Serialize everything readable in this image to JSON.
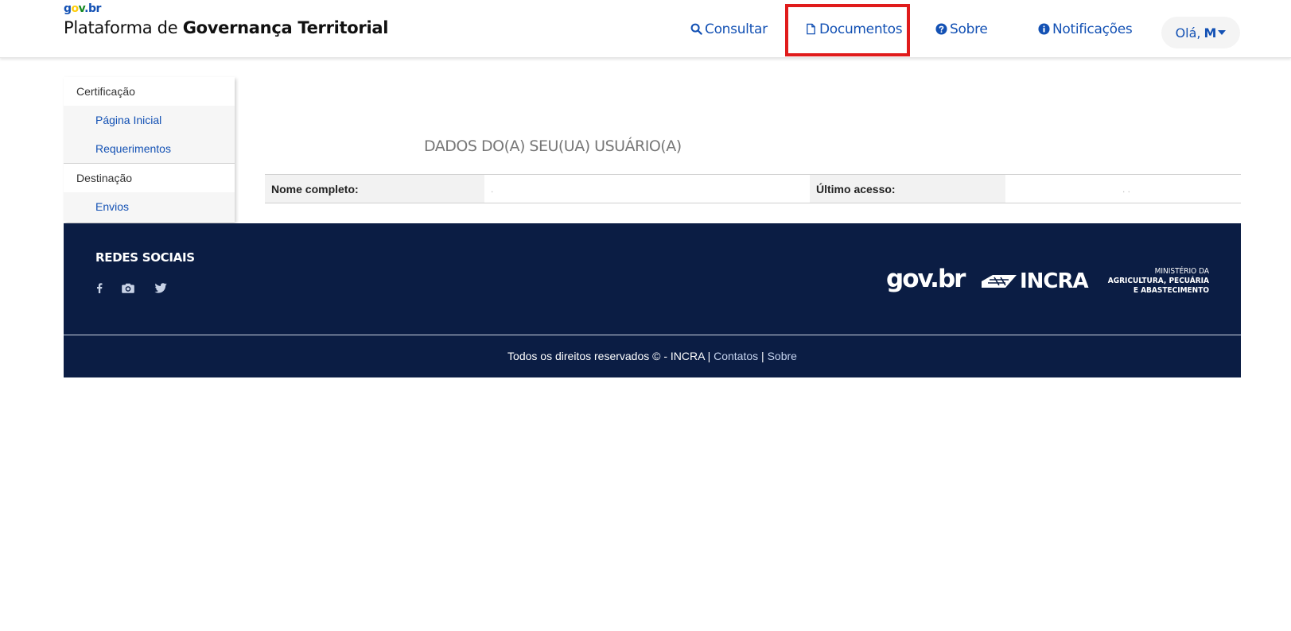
{
  "header": {
    "logo": {
      "g": "g",
      "o": "o",
      "v": "v",
      "dot": ".",
      "br": "br"
    },
    "title_prefix": "Plataforma de ",
    "title_bold": "Governança Territorial",
    "nav": {
      "consultar": "Consultar",
      "documentos": "Documentos",
      "sobre": "Sobre",
      "notificacoes": "Notificações"
    },
    "user_greeting": "Olá,",
    "user_name": "M",
    "icons": [
      "search-icon",
      "file-icon",
      "question-circle-icon",
      "info-circle-icon",
      "caret-down-icon"
    ],
    "highlight_color": "#e01b1b"
  },
  "sidebar": {
    "sections": [
      {
        "label": "Certificação",
        "items": [
          {
            "label": "Página Inicial"
          },
          {
            "label": "Requerimentos"
          }
        ]
      },
      {
        "label": "Destinação",
        "items": [
          {
            "label": "Envios"
          }
        ]
      }
    ]
  },
  "main": {
    "section_title": "DADOS DO(A) SEU(UA) USUÁRIO(A)",
    "table": {
      "nome_label": "Nome completo:",
      "nome_value": ".",
      "acesso_label": "Último acesso:",
      "acesso_value": ". ."
    }
  },
  "footer": {
    "social_title": "REDES SOCIAIS",
    "social_icons": [
      "facebook-icon",
      "instagram-icon",
      "twitter-icon"
    ],
    "logos": {
      "govbr": "gov.br",
      "incra": "INCRA",
      "ministerio_l1": "MINISTÉRIO DA",
      "ministerio_l2": "AGRICULTURA, PECUÁRIA",
      "ministerio_l3": "E ABASTECIMENTO"
    },
    "rights": "Todos os direitos reservados © - INCRA",
    "sep": "|",
    "contatos": "Contatos",
    "sobre": "Sobre"
  },
  "colors": {
    "brand_blue": "#1351b4",
    "footer_bg": "#0b1d44",
    "highlight": "#e01b1b"
  }
}
